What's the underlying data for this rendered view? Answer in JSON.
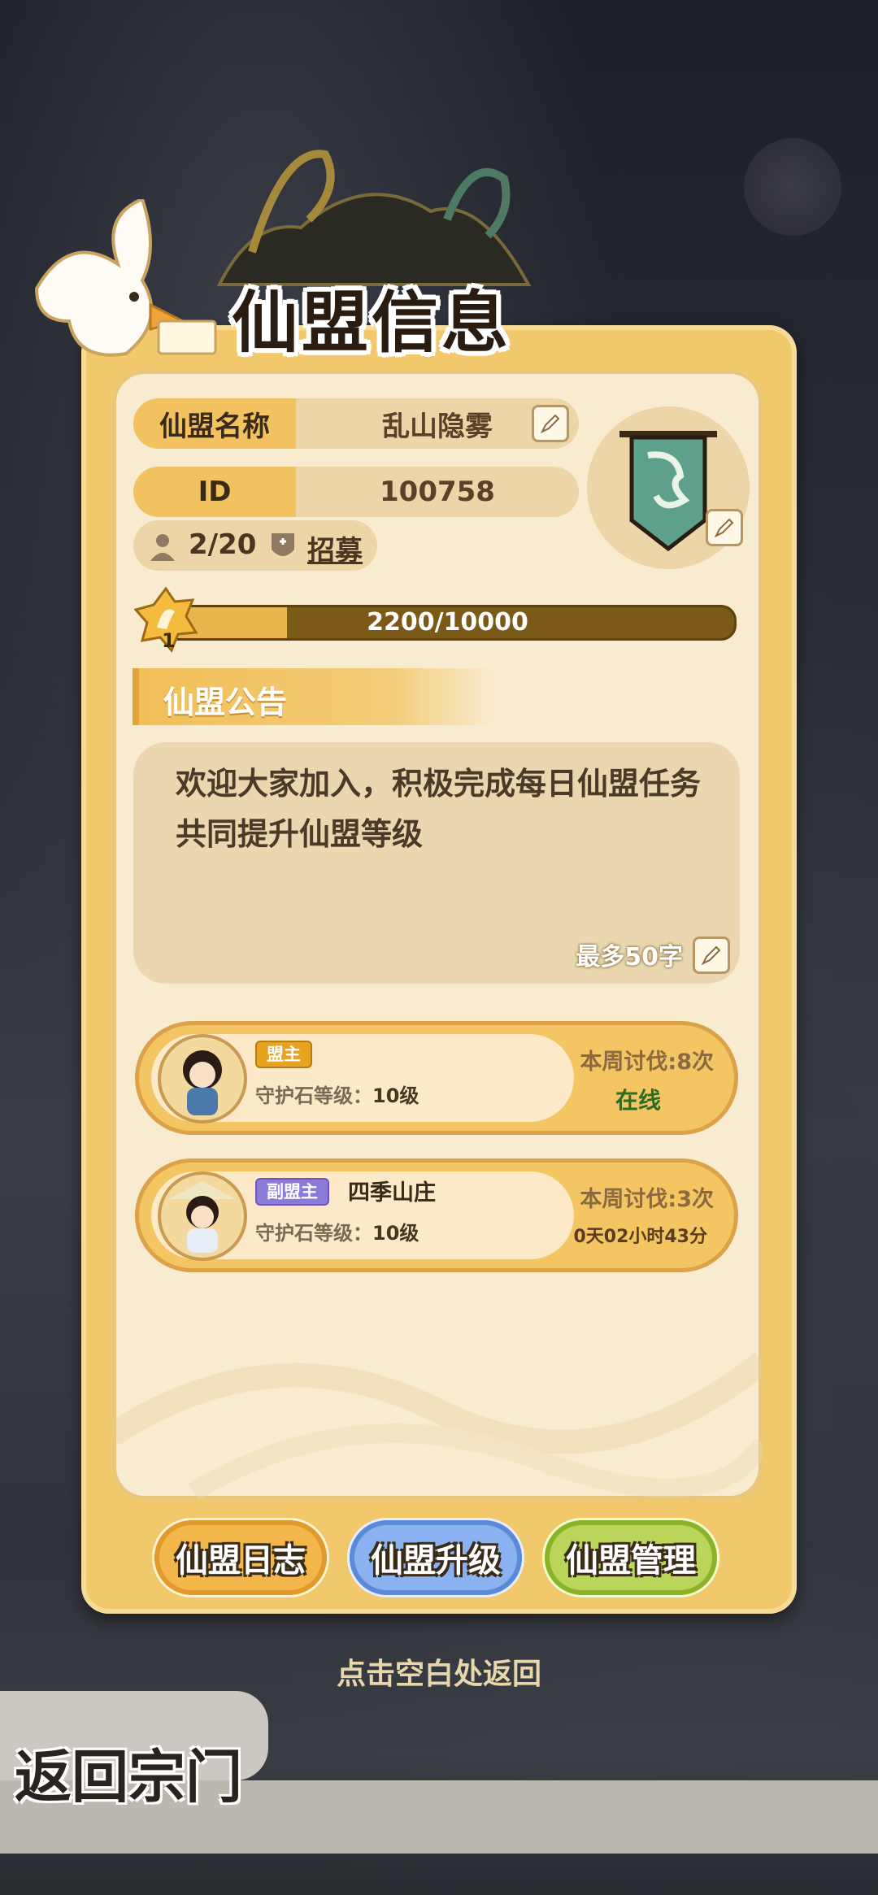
{
  "title": "仙盟信息",
  "info": {
    "name_label": "仙盟名称",
    "name_value": "乱山隐雾",
    "id_label": "ID",
    "id_value": "100758",
    "members": "2/20",
    "recruit": "招募"
  },
  "level": {
    "badge": "1",
    "xp_text": "2200/10000",
    "xp_fraction": 0.22
  },
  "notice": {
    "header": "仙盟公告",
    "text": "欢迎大家加入，积极完成每日仙盟任务共同提升仙盟等级",
    "limit": "最多50字"
  },
  "members_list": [
    {
      "role": "盟主",
      "name": "",
      "stone": "守护石等级：",
      "stone_level": "10级",
      "weekly": "本周讨伐:8次",
      "status": "在线"
    },
    {
      "role": "副盟主",
      "name": "四季山庄",
      "stone": "守护石等级：",
      "stone_level": "10级",
      "weekly": "本周讨伐:3次",
      "status": "0天02小时43分"
    }
  ],
  "buttons": {
    "log": "仙盟日志",
    "upgrade": "仙盟升级",
    "manage": "仙盟管理"
  },
  "hint": "点击空白处返回",
  "back": "返回宗门",
  "colors": {
    "panel": "#f2c86d",
    "inner": "#f8ecd0",
    "online": "#2f6b20",
    "xp_fill": "#e8b64c"
  },
  "icons": [
    "edit-pencil-icon",
    "member-icon",
    "shield-icon",
    "level-star-icon",
    "dragon-banner-icon"
  ]
}
